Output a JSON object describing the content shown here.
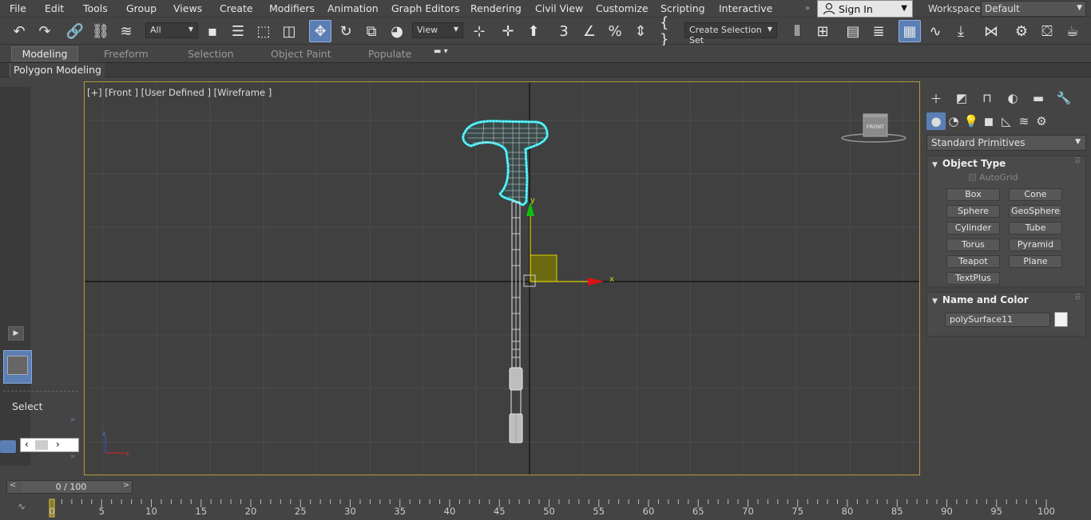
{
  "menu": [
    "File",
    "Edit",
    "Tools",
    "Group",
    "Views",
    "Create",
    "Modifiers",
    "Animation",
    "Graph Editors",
    "Rendering",
    "Civil View",
    "Customize",
    "Scripting",
    "Interactive"
  ],
  "signin": "Sign In",
  "workspaces": {
    "label": "Workspaces:",
    "value": "Default"
  },
  "toolbar": {
    "filter_select": "All",
    "ref_coord_select": "View",
    "selection_set": "Create Selection Set"
  },
  "ribbon": {
    "tabs": [
      "Modeling",
      "Freeform",
      "Selection",
      "Object Paint",
      "Populate"
    ],
    "active_tab": "Modeling",
    "sub_tab": "Polygon Modeling"
  },
  "left_panel": {
    "select_label": "Select"
  },
  "viewport": {
    "label": "[+] [Front ] [User Defined ] [Wireframe ]",
    "viewcube_face": "FRONT",
    "gizmo_x": "x",
    "gizmo_y": "y",
    "corner_axis_x": "x",
    "corner_axis_z": "z"
  },
  "command_panel": {
    "dropdown": "Standard Primitives",
    "object_type": {
      "title": "Object Type",
      "autogrid": "AutoGrid",
      "buttons": [
        "Box",
        "Cone",
        "Sphere",
        "GeoSphere",
        "Cylinder",
        "Tube",
        "Torus",
        "Pyramid",
        "Teapot",
        "Plane",
        "TextPlus"
      ]
    },
    "name_and_color": {
      "title": "Name and Color",
      "name": "polySurface11",
      "color": "#f2f2f2"
    }
  },
  "timeline": {
    "frame_display": "0 / 100",
    "ruler_labels": [
      "0",
      "5",
      "10",
      "15",
      "20",
      "25",
      "30",
      "35",
      "40",
      "45",
      "50",
      "55",
      "60",
      "65",
      "70",
      "75",
      "80",
      "85",
      "90",
      "95",
      "100"
    ]
  },
  "colors": {
    "viewport_bg": "#404040",
    "viewport_border": "#b59a3b",
    "selection_outline": "#2ee6ee",
    "gizmo_x": "#e01010",
    "gizmo_y": "#10c010",
    "gizmo_plane": "#b8a800",
    "active_blue": "#5b7fb5"
  }
}
